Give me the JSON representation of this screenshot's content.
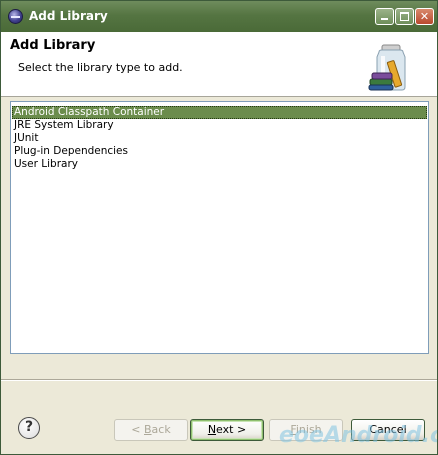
{
  "window": {
    "title": "Add Library",
    "controls": {
      "minimize": "minimize",
      "maximize": "maximize",
      "close": "✕"
    }
  },
  "banner": {
    "heading": "Add Library",
    "description": "Select the library type to add.",
    "icon": "library-jar-icon"
  },
  "library_types": [
    {
      "label": "Android Classpath Container",
      "selected": true
    },
    {
      "label": "JRE System Library",
      "selected": false
    },
    {
      "label": "JUnit",
      "selected": false
    },
    {
      "label": "Plug-in Dependencies",
      "selected": false
    },
    {
      "label": "User Library",
      "selected": false
    }
  ],
  "footer": {
    "help_icon": "?",
    "back": {
      "prefix": "< ",
      "mnemonic": "B",
      "rest": "ack",
      "enabled": false
    },
    "next": {
      "mnemonic": "N",
      "rest": "ext >",
      "enabled": true
    },
    "finish": {
      "prefix": "",
      "mnemonic": "F",
      "rest": "inish",
      "enabled": false
    },
    "cancel": {
      "label": "Cancel",
      "enabled": true
    }
  },
  "watermark": "eoeAndroid.com",
  "colors": {
    "titlebar": "#557542",
    "selection": "#6b8c4c",
    "dialog_bg": "#ece9d8"
  }
}
